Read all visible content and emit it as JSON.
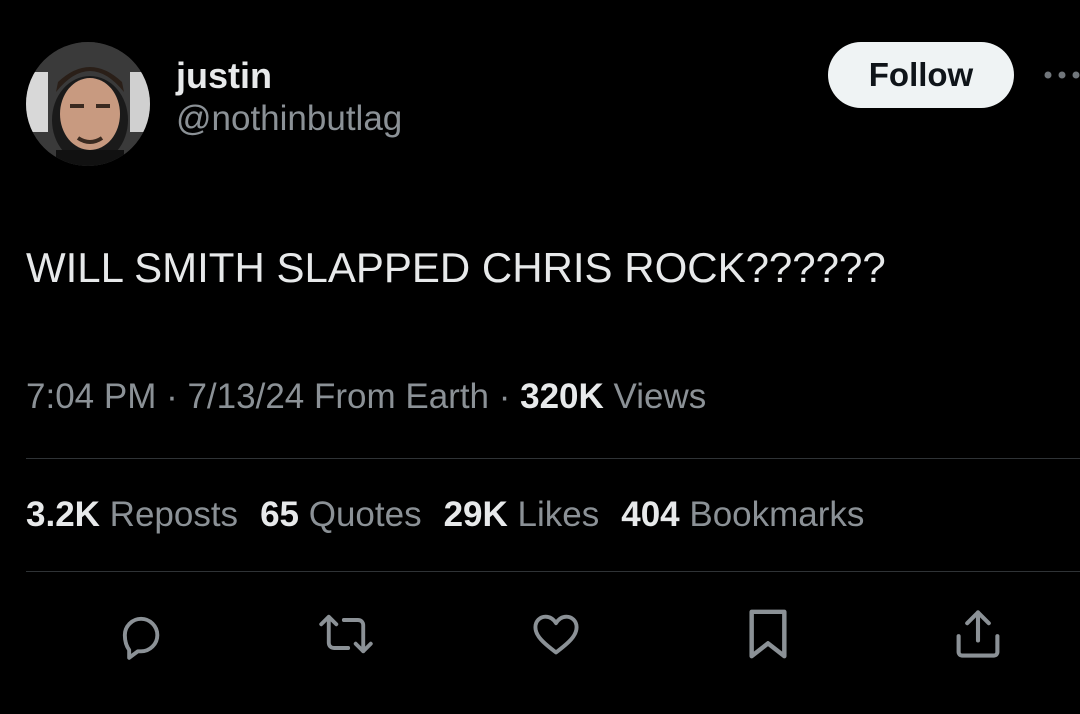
{
  "user": {
    "display_name": "justin",
    "handle": "@nothinbutlag"
  },
  "follow_label": "Follow",
  "tweet": {
    "text": "WILL SMITH SLAPPED CHRIS ROCK??????"
  },
  "meta": {
    "time": "7:04 PM",
    "separator": " · ",
    "date": "7/13/24",
    "location": " From Earth",
    "views_count": "320K",
    "views_label": " Views"
  },
  "stats": {
    "reposts": {
      "count": "3.2K",
      "label": " Reposts"
    },
    "quotes": {
      "count": "65",
      "label": " Quotes"
    },
    "likes": {
      "count": "29K",
      "label": " Likes"
    },
    "bookmarks": {
      "count": "404",
      "label": " Bookmarks"
    }
  },
  "icons": {
    "more": "more-horizontal-icon",
    "reply": "reply-icon",
    "repost": "repost-icon",
    "like": "heart-icon",
    "bookmark": "bookmark-icon",
    "share": "share-icon"
  },
  "colors": {
    "background": "#000000",
    "primary_text": "#e7e9ea",
    "secondary_text": "#8b9196",
    "follow_button": "#eff3f4",
    "divider": "#2f3336"
  }
}
